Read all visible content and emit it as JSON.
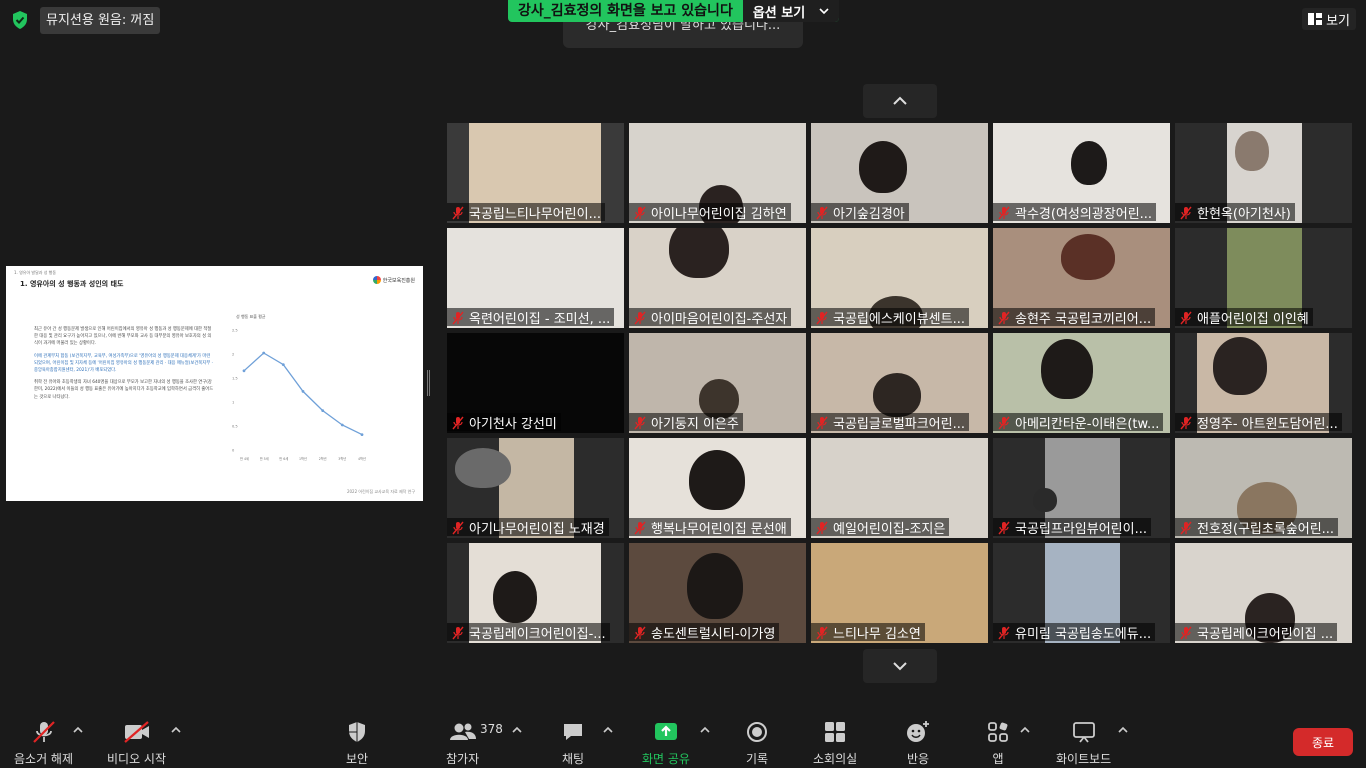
{
  "top": {
    "audio_status": "뮤지션용 원음: 꺼짐",
    "share_banner": "강사_김효정의 화면을 보고 있습니다",
    "view_options": "옵션 보기",
    "speaker_toast": "강사_김효정님이 말하고 있습니다...",
    "view_button": "보기"
  },
  "slide": {
    "breadcrumb": "1. 영유아 발달과 성 행동",
    "title": "1. 영유아의 성 행동과 성인의 태도",
    "logo_text": "한국보육진흥원",
    "para1": "최근 유아 간 성 행동문제 발생으로 인해 어린이집에서의 영유아 성 행동과 성 행동문제에 대한 적절한 대응 및 관리 요구가 높아지고 있으나, 이에 반해 부모와 교사 등 대부분의 영유아 보호자의 성 의식이 과거에 머물러 있는 상황이다.",
    "para2": "이에 관계부처 합동 (보건복지부, 교육부, 여성가족부)으로 '영유아의 성 행동문제 대응체계'가 마련되었으며, 어린이집 및 지자체 등에 '어린이집 영유아의 성 행동문제 관리 · 대응 매뉴얼(보건복지부 · 중앙육아종합지원센터, 2021)'가 배포되었다.",
    "para3": "취학 전 유아와 초등학생의 자녀 640명을 대상으로 부모가 보고한 자녀의 성 행동을 조사한 연구(강한미, 2022)에서 이들의 성 행동 표출은 유아기에 높아지다가 초등학교에 입학하면서 급격히 줄어드는 것으로 나타났다.",
    "footnote": "2022 어린이집 교사교육 자료 제작 연구",
    "chart_data": {
      "type": "line",
      "title": "성 행동 표출 평균",
      "categories": [
        "만 4세",
        "만 5세",
        "만 6세",
        "1학년",
        "2학년",
        "3학년",
        "4학년"
      ],
      "values": [
        1.65,
        2.02,
        1.78,
        1.22,
        0.82,
        0.52,
        0.32
      ],
      "ylim": [
        0,
        2.5
      ],
      "yticks": [
        "0",
        "0.5",
        "1",
        "1.5",
        "2",
        "2.5"
      ],
      "line_color": "#6fa0d8"
    }
  },
  "gallery": {
    "tiles": [
      {
        "name": "국공립느티나무어린이..."
      },
      {
        "name": "아이나무어린이집 김하연"
      },
      {
        "name": "아기숲김경아"
      },
      {
        "name": "곽수경(여성의광장어린..."
      },
      {
        "name": "한현옥(아기천사)"
      },
      {
        "name": "옥련어린이집 - 조미선, ..."
      },
      {
        "name": "아이마음어린이집-주선자"
      },
      {
        "name": "국공립에스케이뷰센트..."
      },
      {
        "name": "송현주 국공립코끼리어..."
      },
      {
        "name": "애플어린이집 이인혜"
      },
      {
        "name": "아기천사 강선미"
      },
      {
        "name": "아기둥지 이은주"
      },
      {
        "name": "국공립글로벌파크어린..."
      },
      {
        "name": "아메리칸타운-이태은(tw..."
      },
      {
        "name": "정영주- 아트윈도담어린..."
      },
      {
        "name": "아기나무어린이집 노재경"
      },
      {
        "name": "행복나무어린이집 문선애"
      },
      {
        "name": "예일어린이집-조지은"
      },
      {
        "name": "국공립프라임뷰어린이..."
      },
      {
        "name": "전호정(구립초록숲어린..."
      },
      {
        "name": "국공립레이크어린이집-..."
      },
      {
        "name": "송도센트럴시티-이가영"
      },
      {
        "name": "느티나무 김소연"
      },
      {
        "name": "유미림 국공립송도에듀..."
      },
      {
        "name": "국공립레이크어린이집 ..."
      }
    ]
  },
  "toolbar": {
    "unmute": "음소거 해제",
    "start_video": "비디오 시작",
    "security": "보안",
    "participants": "참가자",
    "participant_count": "378",
    "chat": "채팅",
    "share_screen": "화면 공유",
    "record": "기록",
    "breakout": "소회의실",
    "reactions": "반응",
    "apps": "앱",
    "whiteboard": "화이트보드",
    "end": "종료"
  },
  "colors": {
    "share_green": "#22c55e",
    "end_red": "#d42a2a",
    "mute_red": "#e02424",
    "background": "#1a1a1a"
  }
}
